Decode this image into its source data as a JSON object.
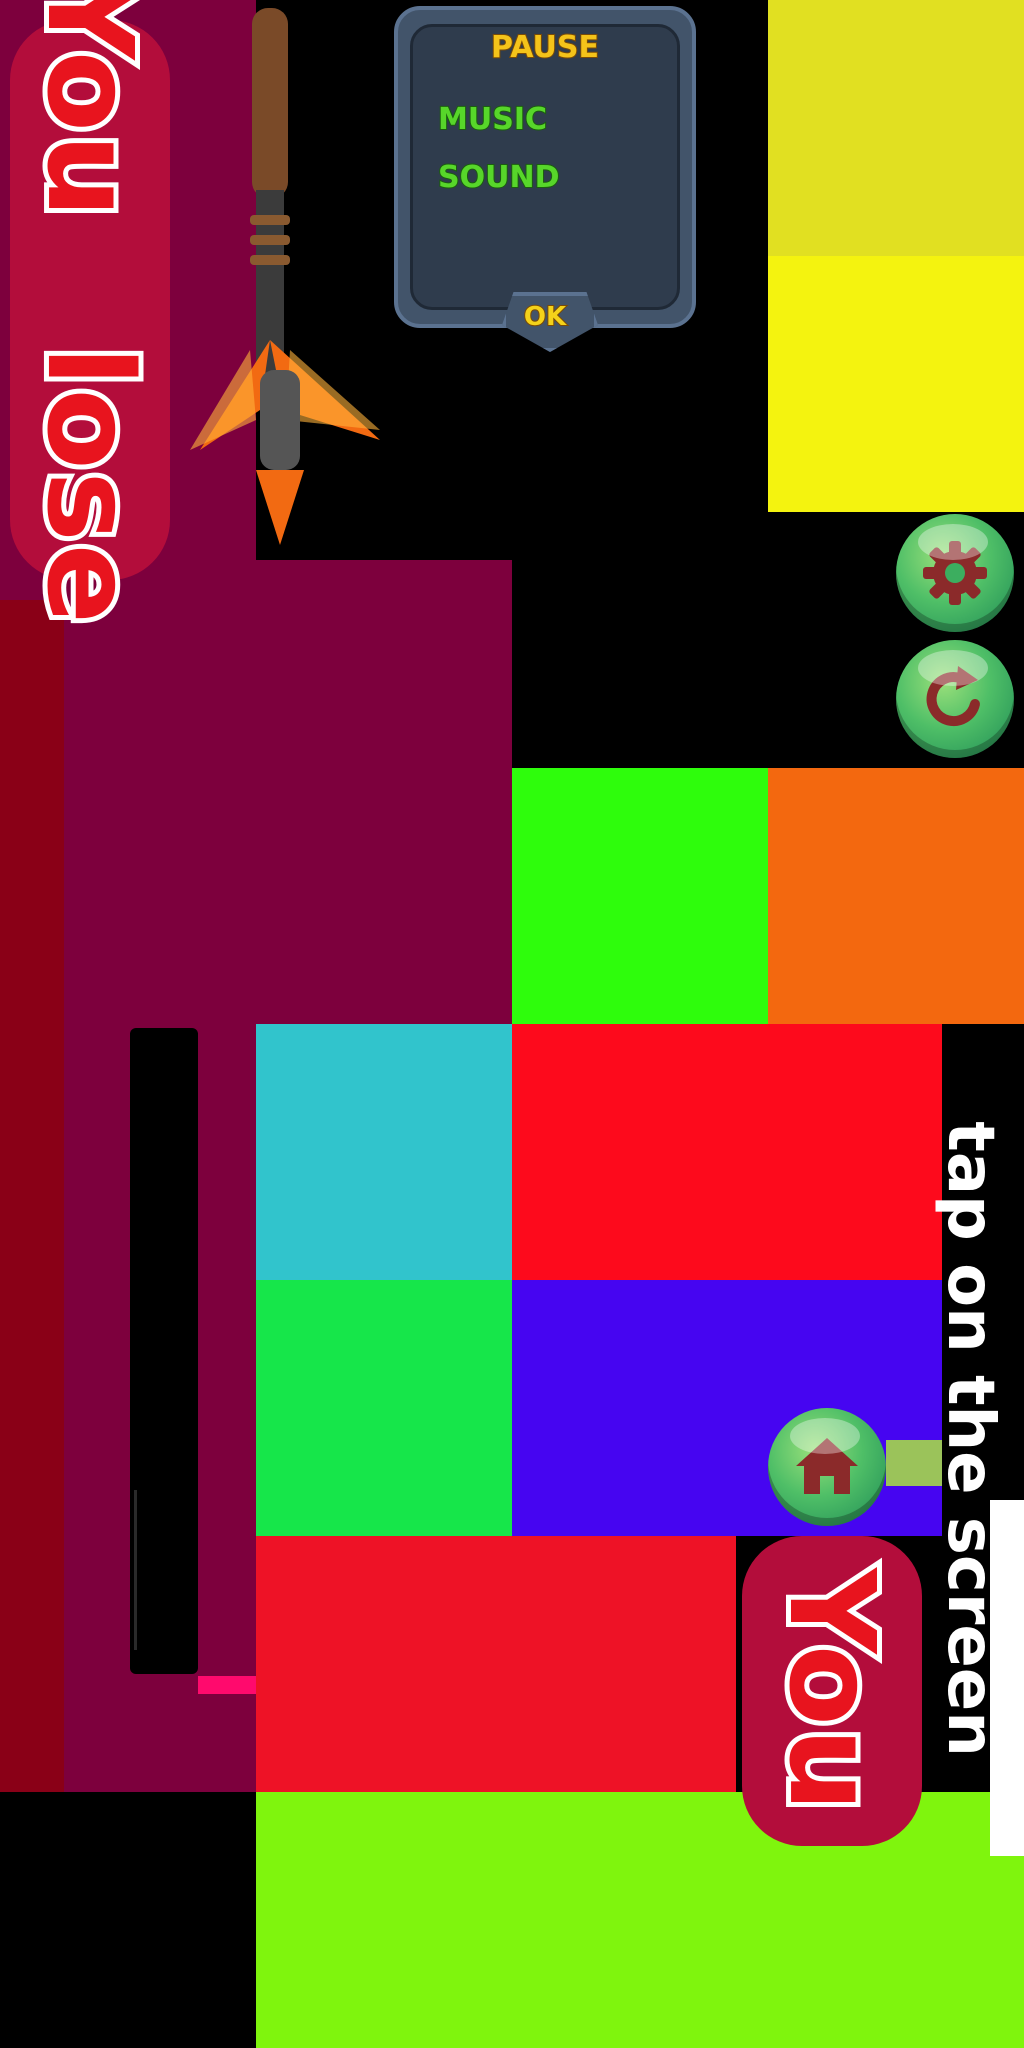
{
  "colors": {
    "background": "#000000",
    "maroon": "#7d003d",
    "dark_red": "#8a0017",
    "yellow_top": "#e1e021",
    "yellow": "#f4f30f",
    "green": "#2efd0c",
    "orange": "#f3680f",
    "teal": "#31c4cc",
    "red": "#fd0a1c",
    "lime_green": "#16e64a",
    "purple": "#4605f1",
    "crimson": "#ee1226",
    "chartreuse": "#7ff50d",
    "pink": "#ff0a6d",
    "white": "#ffffff"
  },
  "sprites": {
    "you_lose_banner": {
      "word1": "You",
      "word2": "lose"
    },
    "you_banner": {
      "word": "You"
    },
    "hint_text": "tap on the screen"
  },
  "pause_panel": {
    "title": "PAUSE",
    "music_label": "MUSIC",
    "sound_label": "SOUND",
    "ok_label": "OK"
  },
  "buttons": {
    "settings_icon": "gear-icon",
    "restart_icon": "restart-icon",
    "home_icon": "home-icon"
  }
}
